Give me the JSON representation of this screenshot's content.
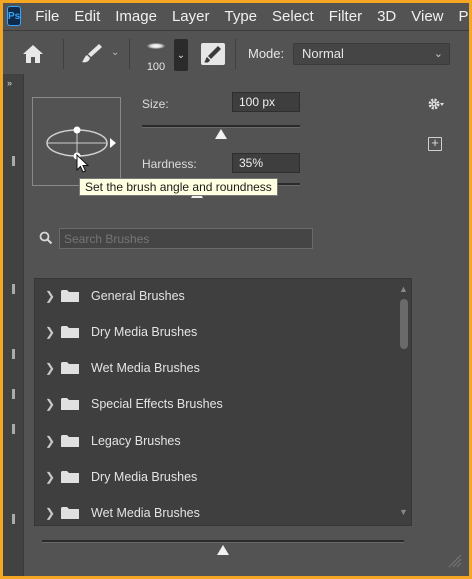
{
  "menubar": {
    "logo": "Ps",
    "items": [
      "File",
      "Edit",
      "Image",
      "Layer",
      "Type",
      "Select",
      "Filter",
      "3D",
      "View",
      "Pl"
    ]
  },
  "options_bar": {
    "brush_size": "100",
    "mode_label": "Mode:",
    "mode_value": "Normal",
    "icons": [
      "home-icon",
      "brush-icon",
      "toggle-brush-panel-icon"
    ]
  },
  "brush_panel": {
    "size_label": "Size:",
    "size_value": "100 px",
    "size_slider_fraction": 0.5,
    "hardness_label": "Hardness:",
    "hardness_value": "35%",
    "hardness_slider_fraction": 0.35,
    "tooltip": "Set the brush angle and roundness",
    "search_placeholder": "Search Brushes",
    "brush_groups": [
      "General Brushes",
      "Dry Media Brushes",
      "Wet Media Brushes",
      "Special Effects Brushes",
      "Legacy Brushes",
      "Dry Media Brushes",
      "Wet Media Brushes"
    ],
    "scroll_position_fraction": 0.0,
    "preview_slider_fraction": 0.5
  },
  "colors": {
    "border_accent": "#f5a623",
    "panel_bg": "#535353",
    "list_bg": "#3f3f3f",
    "tooltip_bg": "#ffffe1",
    "ps_blue": "#31a8ff"
  }
}
